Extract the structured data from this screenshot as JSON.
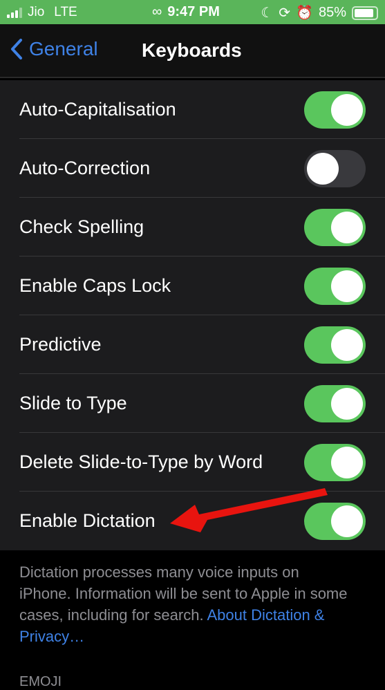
{
  "status_bar": {
    "carrier": "Jio",
    "network": "LTE",
    "time": "9:47 PM",
    "battery": "85%",
    "icons": [
      "signal-bars-icon",
      "link-icon",
      "moon-icon",
      "rotation-lock-icon",
      "alarm-icon",
      "battery-icon"
    ]
  },
  "nav": {
    "back_label": "General",
    "title": "Keyboards"
  },
  "settings": [
    {
      "label": "Auto-Capitalisation",
      "on": true
    },
    {
      "label": "Auto-Correction",
      "on": false
    },
    {
      "label": "Check Spelling",
      "on": true
    },
    {
      "label": "Enable Caps Lock",
      "on": true
    },
    {
      "label": "Predictive",
      "on": true
    },
    {
      "label": "Slide to Type",
      "on": true
    },
    {
      "label": "Delete Slide-to-Type by Word",
      "on": true
    },
    {
      "label": "Enable Dictation",
      "on": true
    }
  ],
  "footer": {
    "text": "Dictation processes many voice inputs on iPhone. Information will be sent to Apple in some cases, including for search. ",
    "link": "About Dictation & Privacy…"
  },
  "next_section": "EMOJI",
  "annotation": {
    "type": "red-arrow",
    "points_to": "Enable Dictation",
    "color": "#e8140f"
  }
}
